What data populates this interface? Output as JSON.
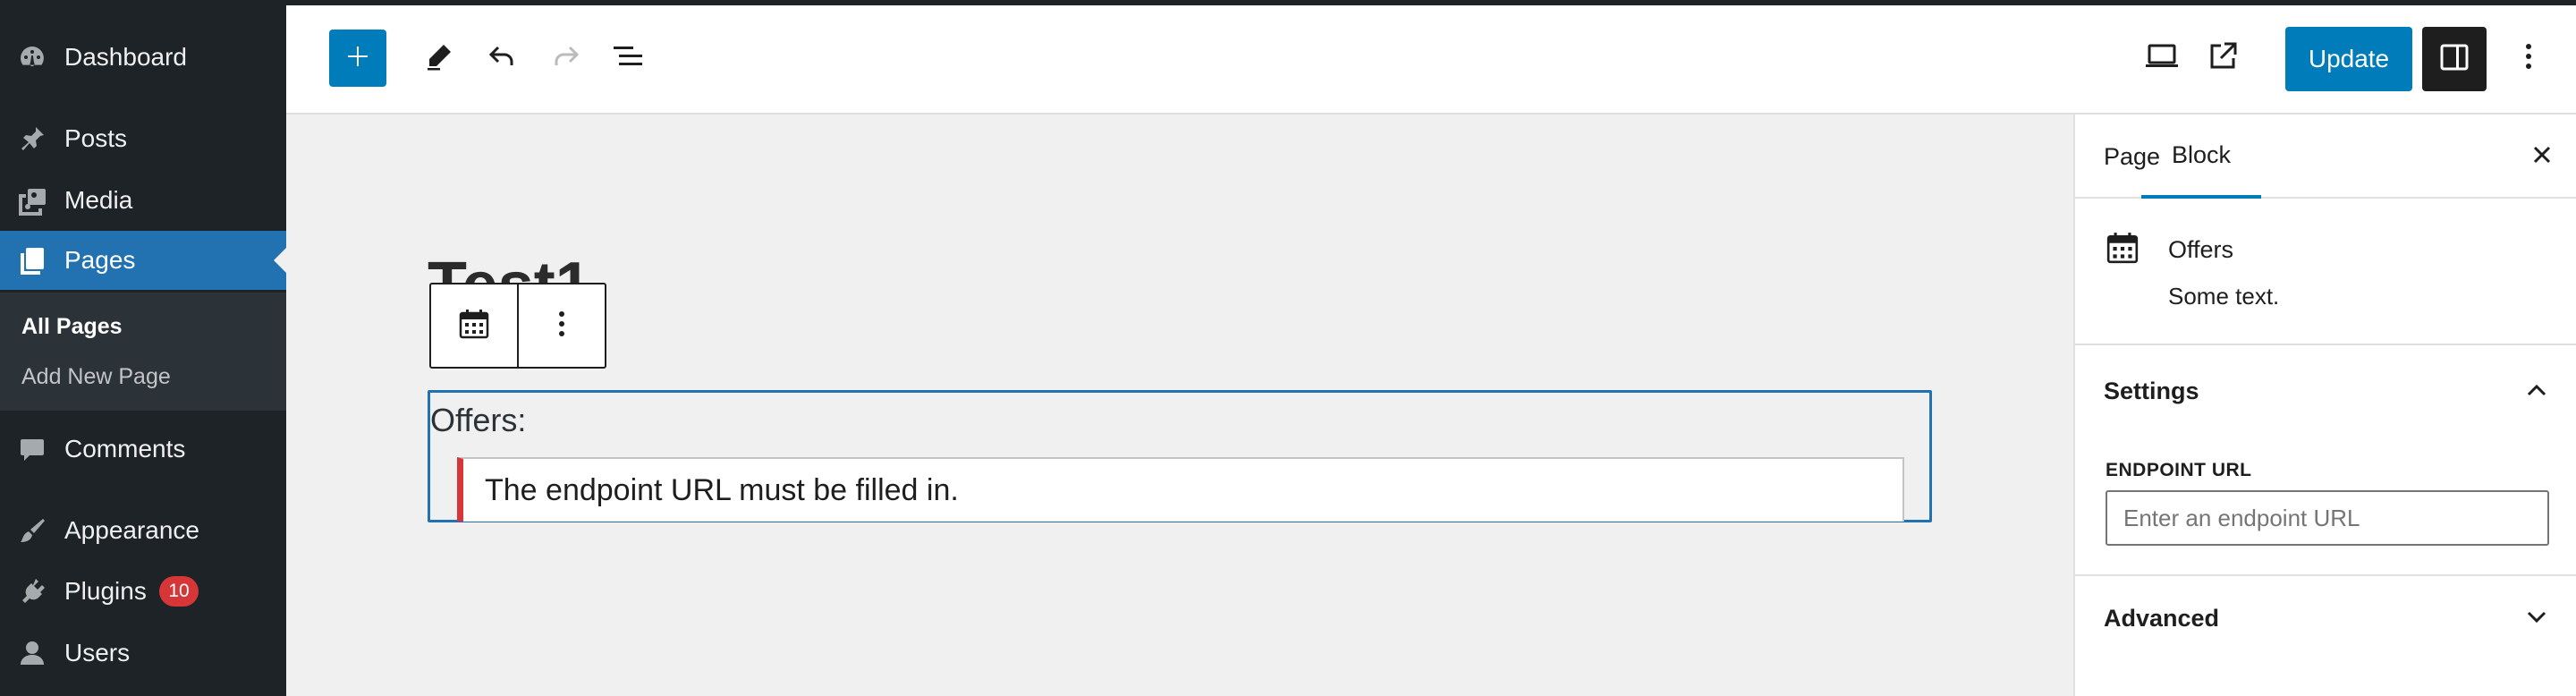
{
  "admin_menu": {
    "items": [
      {
        "label": "Dashboard",
        "icon": "dashboard-icon"
      },
      {
        "label": "Posts",
        "icon": "pin-icon"
      },
      {
        "label": "Media",
        "icon": "media-icon"
      },
      {
        "label": "Pages",
        "icon": "pages-icon",
        "active": true
      },
      {
        "label": "Comments",
        "icon": "comment-icon"
      },
      {
        "label": "Appearance",
        "icon": "brush-icon"
      },
      {
        "label": "Plugins",
        "icon": "plugin-icon",
        "badge": "10"
      },
      {
        "label": "Users",
        "icon": "user-icon"
      }
    ],
    "submenu": [
      {
        "label": "All Pages",
        "current": true
      },
      {
        "label": "Add New Page"
      }
    ]
  },
  "header": {
    "inserter_icon": "plus-icon",
    "tools_icon": "pencil-icon",
    "undo_icon": "undo-icon",
    "redo_icon": "redo-icon",
    "list_view_icon": "list-view-icon",
    "preview_icon": "laptop-icon",
    "view_page_icon": "external-link-icon",
    "update_label": "Update",
    "settings_icon": "sidebar-icon",
    "options_icon": "more-vertical-icon"
  },
  "canvas": {
    "page_title": "Test1",
    "block_label": "Offers:",
    "notice": "The endpoint URL must be filled in."
  },
  "inspector": {
    "tabs": [
      "Page",
      "Block"
    ],
    "active_tab": "Block",
    "block_card": {
      "title": "Offers",
      "description": "Some text.",
      "icon": "calendar-icon"
    },
    "settings": {
      "title": "Settings",
      "field_label": "ENDPOINT URL",
      "field_placeholder": "Enter an endpoint URL",
      "field_value": ""
    },
    "advanced": {
      "title": "Advanced"
    }
  },
  "colors": {
    "admin_bg": "#1d2327",
    "admin_submenu_bg": "#2c3338",
    "accent": "#007cba",
    "active_menu": "#2271b1",
    "error": "#d63638",
    "canvas_bg": "#f0f0f0"
  }
}
